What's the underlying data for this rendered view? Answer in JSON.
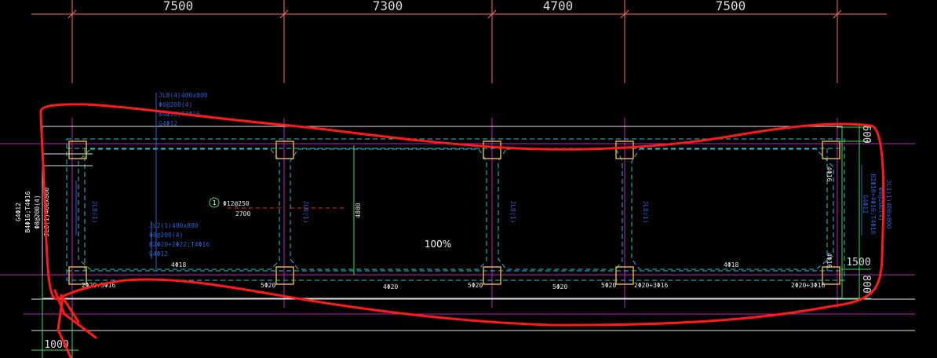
{
  "zoom_label": "100%",
  "top_dimensions": [
    "7500",
    "7300",
    "4700",
    "7500"
  ],
  "right_dimensions": [
    "600",
    "1500",
    "800"
  ],
  "bottom_dimension": "1000",
  "beam_notes": {
    "top_beam": [
      "JL8(4)400x800",
      "Φ6@200(4)",
      "B4Φ16;T4Φ16",
      "G4Φ12"
    ],
    "mid_beam": [
      "JL2(1)400x800",
      "Φ6@200(4)",
      "B2Φ20+2Φ22;T4Φ16",
      "G4Φ12"
    ],
    "right_beam": [
      "JL1(1)400x800",
      "Φ8@200(4)",
      "B2Φ20+2Φ16;T4Φ16",
      "G4Φ12"
    ],
    "left_vertical": [
      "JL8(1)400x800",
      "Φ8@200(4)",
      "B4Φ16;T4Φ16",
      "G4Φ12"
    ],
    "right_vertical_a": [
      "B2Φ18+4Φ16;T4Φ16"
    ],
    "right_vertical_b": [
      "G4Φ12"
    ]
  },
  "slab_label": "Φ12@250",
  "slab_span": "2700",
  "circle_mark": "1",
  "wall_labels": [
    "JL8(1)",
    "JL8(1)",
    "JL8(1)",
    "JL8(1)"
  ],
  "center_span_label": "4800",
  "rebar_labels": {
    "top_left": "4Φ18",
    "top_right": "4Φ18",
    "bottom": [
      "2Φ20+3Φ16",
      "5Φ20",
      "4Φ20",
      "5Φ20",
      "5Φ20",
      "5Φ20",
      "2Φ20+3Φ16",
      "2Φ20+3Φ16"
    ],
    "corner_right_top": "4Φ16",
    "corner_right_bottom": "4Φ16"
  }
}
